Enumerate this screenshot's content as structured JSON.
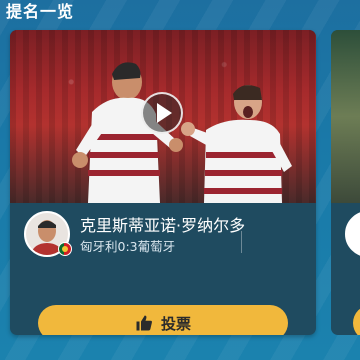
{
  "section": {
    "title": "提名一览"
  },
  "card": {
    "player_name": "克里斯蒂亚诺·罗纳尔多",
    "match_score": "匈牙利0:3葡萄牙",
    "vote_label": "投票"
  },
  "colors": {
    "background": "#1b79a8",
    "card": "#1f4b60",
    "vote_button": "#f1b83c",
    "jersey_red": "#b3322f"
  },
  "icons": {
    "play": "play-icon",
    "thumbs_up": "thumbs-up-icon",
    "flag": "portugal-flag-icon"
  }
}
